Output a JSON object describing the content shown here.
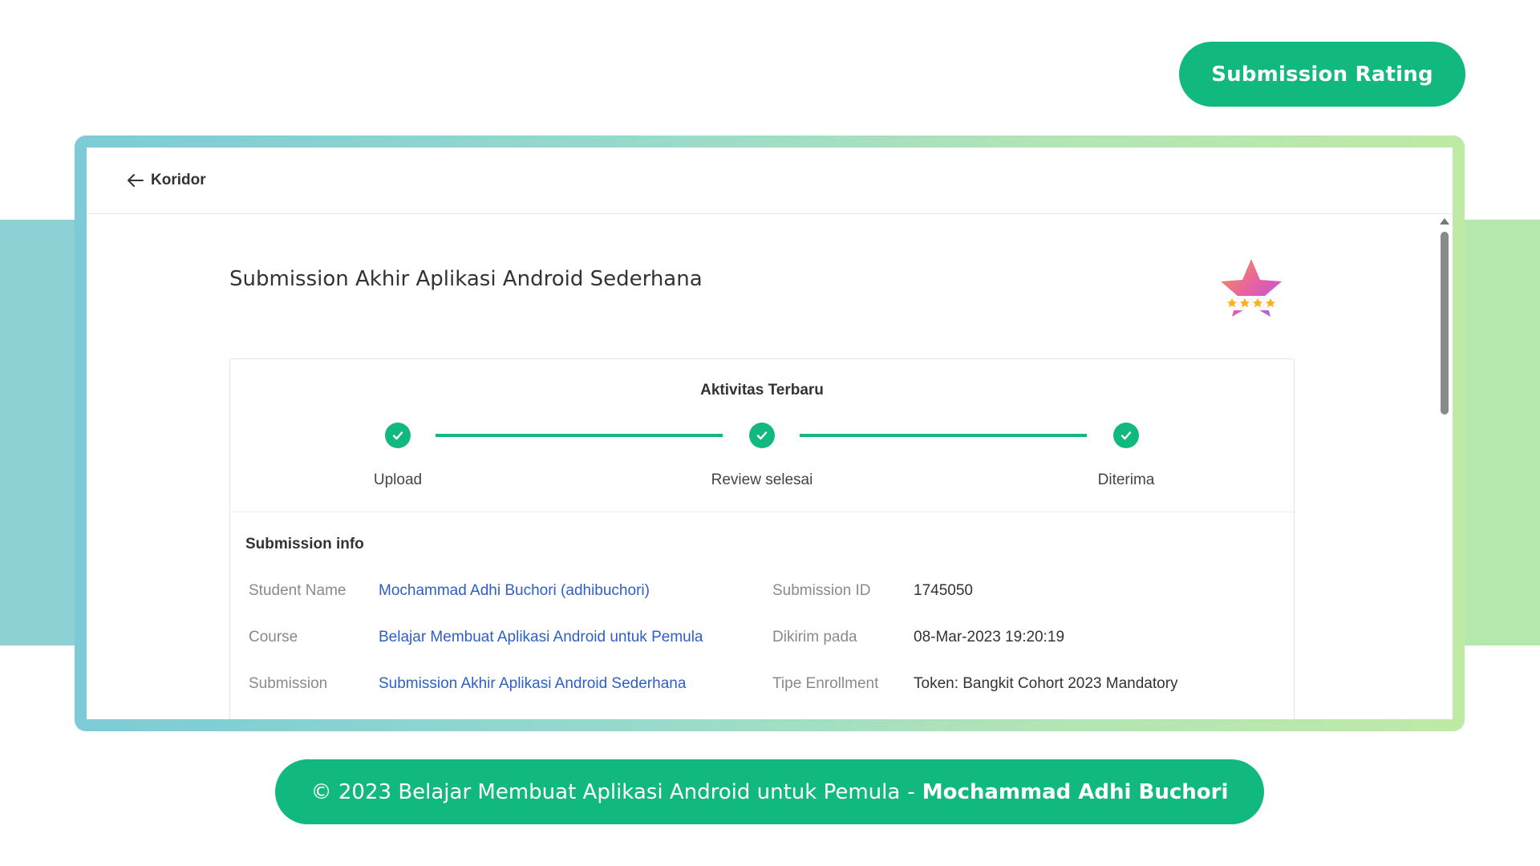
{
  "rating_button": {
    "label": "Submission Rating"
  },
  "topbar": {
    "back_label": "Koridor"
  },
  "page": {
    "title": "Submission Akhir Aplikasi Android Sederhana"
  },
  "activity": {
    "title": "Aktivitas Terbaru",
    "steps": [
      {
        "label": "Upload"
      },
      {
        "label": "Review selesai"
      },
      {
        "label": "Diterima"
      }
    ]
  },
  "info": {
    "title": "Submission info",
    "student_name_label": "Student Name",
    "student_name_value": "Mochammad Adhi Buchori (adhibuchori)",
    "course_label": "Course",
    "course_value": "Belajar Membuat Aplikasi Android untuk Pemula",
    "submission_label": "Submission",
    "submission_value": "Submission Akhir Aplikasi Android Sederhana",
    "submission_id_label": "Submission ID",
    "submission_id_value": "1745050",
    "sent_at_label": "Dikirim pada",
    "sent_at_value": "08-Mar-2023 19:20:19",
    "enrollment_label": "Tipe Enrollment",
    "enrollment_value": "Token: Bangkit Cohort 2023 Mandatory"
  },
  "footer": {
    "text": "© 2023 Belajar Membuat Aplikasi Android untuk Pemula",
    "separator": "-",
    "author": "Mochammad Adhi Buchori"
  },
  "colors": {
    "accent": "#12b97f",
    "link": "#2f5fc4",
    "band_left": "#8dd1d4",
    "band_right": "#b5e8ad"
  },
  "badge": {
    "stars": 4
  }
}
